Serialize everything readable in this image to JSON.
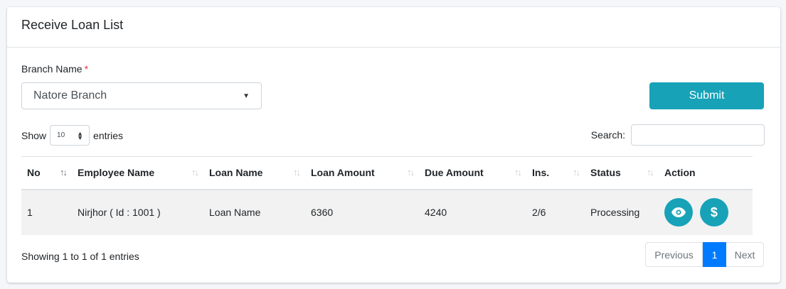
{
  "card": {
    "title": "Receive Loan List"
  },
  "form": {
    "branch_label": "Branch Name",
    "required_mark": "*",
    "branch_value": "Natore Branch",
    "submit_label": "Submit"
  },
  "table_controls": {
    "show_label": "Show",
    "page_length": "10",
    "entries_label": "entries",
    "search_label": "Search:",
    "search_value": ""
  },
  "table": {
    "columns": [
      "No",
      "Employee Name",
      "Loan Name",
      "Loan Amount",
      "Due Amount",
      "Ins.",
      "Status",
      "Action"
    ],
    "rows": [
      {
        "no": "1",
        "employee": "Nirjhor ( Id : 1001 )",
        "loan_name": "Loan Name",
        "loan_amount": "6360",
        "due_amount": "4240",
        "ins": "2/6",
        "status": "Processing",
        "actions": [
          "eye-icon",
          "dollar-icon"
        ]
      }
    ]
  },
  "footer": {
    "info": "Showing 1 to 1 of 1 entries",
    "prev_label": "Previous",
    "page": "1",
    "next_label": "Next"
  },
  "colors": {
    "accent": "#17a2b8",
    "page_active": "#007bff",
    "required": "#dc3545"
  }
}
